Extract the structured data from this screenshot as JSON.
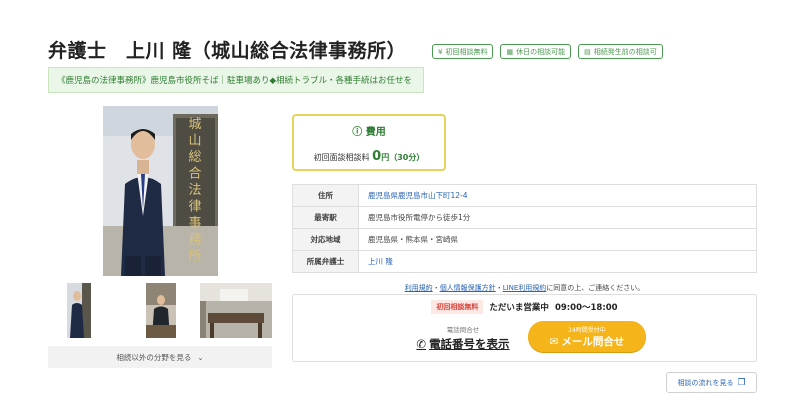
{
  "header": {
    "title": "弁護士　上川 隆（城山総合法律事務所）",
    "badges": [
      {
        "icon": "yen-icon",
        "glyph": "¥",
        "label": "初回相談無料"
      },
      {
        "icon": "calendar-icon",
        "glyph": "▦",
        "label": "休日の相談可能"
      },
      {
        "icon": "document-icon",
        "glyph": "▤",
        "label": "相続発生前の相談可"
      }
    ]
  },
  "catchphrase": "《鹿児島の法律事務所》鹿児島市役所そば｜駐車場あり◆相続トラブル・各種手続はお任せを",
  "photo": {
    "sign_text": "城山総合法律事務所"
  },
  "more_fields_label": "相続以外の分野を見る",
  "fee": {
    "heading": "費用",
    "label": "初回面談相談料",
    "amount": "0",
    "unit": "円（30分）"
  },
  "info": {
    "rows": [
      {
        "key": "住所",
        "value": "鹿児島県鹿児島市山下町12-4"
      },
      {
        "key": "最寄駅",
        "value": "鹿児島市役所電停から徒歩1分"
      },
      {
        "key": "対応地域",
        "value": "鹿児島県・熊本県・宮崎県"
      },
      {
        "key": "所属弁護士",
        "value": "上川 隆"
      }
    ]
  },
  "consent": {
    "link1": "利用規約",
    "sep1": "・",
    "link2": "個人情報保護方針",
    "sep2": "・",
    "link3": "LINE利用規約",
    "tail": "に同意の上、ご連絡ください。"
  },
  "contact": {
    "free_tag": "初回相談無料",
    "status": "ただいま営業中",
    "hours": "09:00〜18:00",
    "phone_sub": "電話問合せ",
    "phone_label": "電話番号を表示",
    "mail_sub": "24時間受付中",
    "mail_label": "メール問合せ"
  },
  "flow_button": "相談の流れを見る",
  "colors": {
    "accent_green": "#2e7d32",
    "badge_green": "#4c9a52",
    "fee_border": "#e8d25a",
    "mail_button": "#f4b41a",
    "link_blue": "#2a64b3",
    "free_tag_red": "#d9463d"
  }
}
